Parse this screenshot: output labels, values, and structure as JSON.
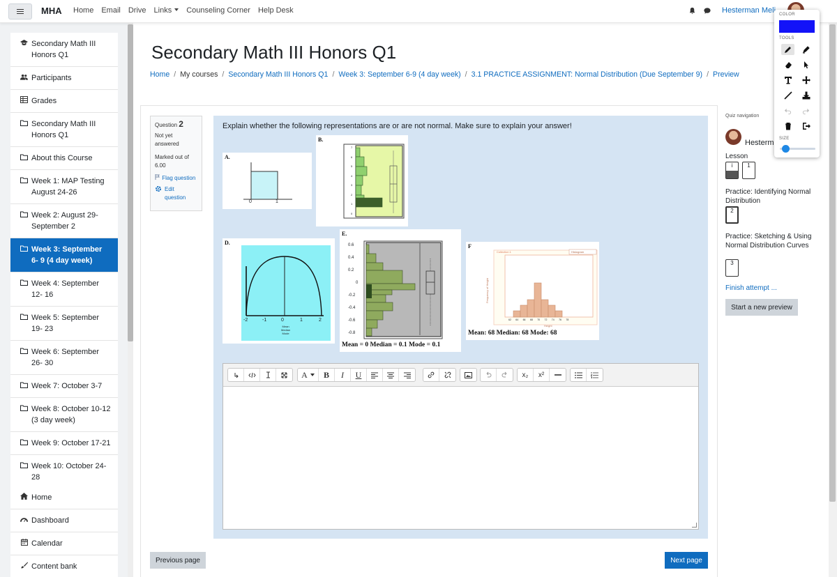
{
  "topbar": {
    "brand": "MHA",
    "nav": [
      "Home",
      "Email",
      "Drive",
      "Links",
      "Counseling Corner",
      "Help Desk"
    ],
    "user_name": "Hesterman Meli"
  },
  "drawtool": {
    "color_label": "COLOR",
    "tools_label": "TOOLS",
    "size_label": "SIZE",
    "color": "#1313f8",
    "size_fraction": 0.1
  },
  "sidebar": {
    "course_items": [
      {
        "icon": "cap-icon",
        "label": "Secondary Math III Honors Q1"
      },
      {
        "icon": "users-icon",
        "label": "Participants"
      },
      {
        "icon": "table-icon",
        "label": "Grades"
      },
      {
        "icon": "folder-icon",
        "label": "Secondary Math III Honors Q1"
      },
      {
        "icon": "folder-icon",
        "label": "About this Course"
      },
      {
        "icon": "folder-icon",
        "label": "Week 1: MAP Testing August 24-26"
      },
      {
        "icon": "folder-icon",
        "label": "Week 2: August 29- September 2"
      },
      {
        "icon": "folder-icon",
        "label": "Week 3: September 6- 9 (4 day week)"
      },
      {
        "icon": "folder-icon",
        "label": "Week 4: September 12- 16"
      },
      {
        "icon": "folder-icon",
        "label": "Week 5: September 19- 23"
      },
      {
        "icon": "folder-icon",
        "label": "Week 6: September 26- 30"
      },
      {
        "icon": "folder-icon",
        "label": "Week 7: October 3-7"
      },
      {
        "icon": "folder-icon",
        "label": "Week 8: October 10-12 (3 day week)"
      },
      {
        "icon": "folder-icon",
        "label": "Week 9: October 17-21"
      },
      {
        "icon": "folder-icon",
        "label": "Week 10: October 24- 28"
      }
    ],
    "active_index": 7,
    "site_items": [
      {
        "icon": "home-icon",
        "label": "Home"
      },
      {
        "icon": "dashboard-icon",
        "label": "Dashboard"
      },
      {
        "icon": "calendar-icon",
        "label": "Calendar"
      },
      {
        "icon": "brush-icon",
        "label": "Content bank"
      }
    ]
  },
  "page": {
    "title": "Secondary Math III Honors Q1",
    "breadcrumb": [
      "Home",
      "My courses",
      "Secondary Math III Honors Q1",
      "Week 3: September 6-9 (4 day week)",
      "3.1 PRACTICE ASSIGNMENT: Normal Distribution (Due September 9)",
      "Preview"
    ]
  },
  "question": {
    "label": "Question",
    "number": "2",
    "status": "Not yet answered",
    "marked": "Marked out of 6.00",
    "flag": "Flag question",
    "edit": "Edit question",
    "text": "Explain whether the following representations are or are not normal.  Make sure to explain your answer!"
  },
  "figures": {
    "a": {
      "label": "A.",
      "ticks": [
        "0",
        "1"
      ]
    },
    "b": {
      "label": "B.",
      "ticks": [
        "7",
        "6",
        "5",
        "4",
        "3",
        "2",
        "1",
        "0"
      ]
    },
    "d": {
      "label": "D.",
      "ticks": [
        "-2",
        "-1",
        "0",
        "1",
        "2"
      ],
      "axis_note": [
        "Mean",
        "Median",
        "Mode"
      ]
    },
    "e": {
      "label": "E.",
      "ticks": [
        "0.6",
        "0.4",
        "0.2",
        "0",
        "-0.2",
        "-0.4",
        "-0.6",
        "-0.8"
      ],
      "stats": "Mean = 0     Median = 0.1   Mode = 0.1"
    },
    "f": {
      "label": "F",
      "legend": "Collection 1",
      "tag": "Histogram",
      "ylabel": "Frequency of Height",
      "xlabel": "Height",
      "ticks": [
        "62",
        "64",
        "66",
        "68",
        "70",
        "72",
        "74",
        "76",
        "78"
      ],
      "stats": "Mean: 68     Median: 68    Mode: 68"
    }
  },
  "editor": {
    "font_button": "A",
    "bold": "B",
    "italic": "I",
    "underline": "U",
    "sub": "x₂",
    "sup": "x²"
  },
  "buttons": {
    "previous": "Previous page",
    "next": "Next page"
  },
  "quiz_nav": {
    "title": "Quiz navigation",
    "user": "Hesterman",
    "sections": [
      {
        "label": "Lesson",
        "buttons": [
          "i",
          "1"
        ]
      },
      {
        "label": "Practice: Identifying Normal Distribution",
        "buttons": [
          "2"
        ]
      },
      {
        "label": "Practice: Sketching & Using Normal Distribution Curves",
        "buttons": [
          "3"
        ]
      }
    ],
    "finish": "Finish attempt ...",
    "new_preview": "Start a new preview"
  }
}
